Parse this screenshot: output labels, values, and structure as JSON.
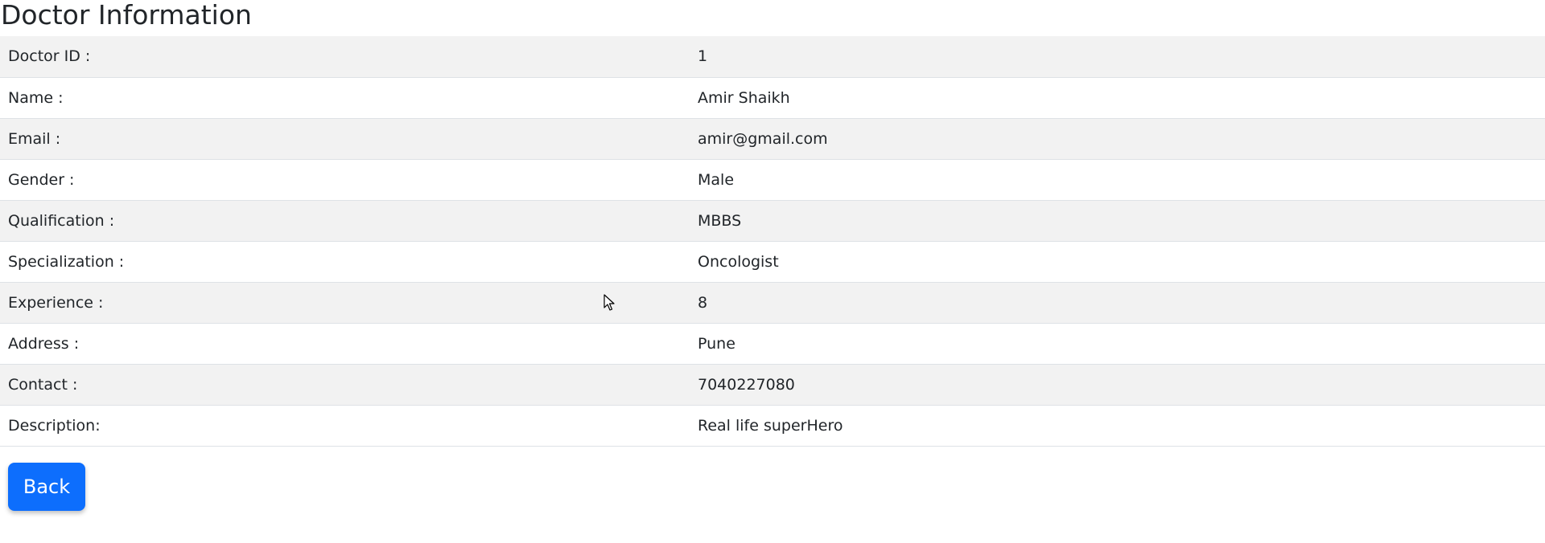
{
  "page": {
    "title": "Doctor Information"
  },
  "doctor": {
    "rows": [
      {
        "label": "Doctor ID :",
        "value": "1"
      },
      {
        "label": "Name :",
        "value": "Amir Shaikh"
      },
      {
        "label": "Email :",
        "value": "amir@gmail.com"
      },
      {
        "label": "Gender :",
        "value": "Male"
      },
      {
        "label": "Qualification :",
        "value": "MBBS"
      },
      {
        "label": "Specialization :",
        "value": "Oncologist"
      },
      {
        "label": "Experience :",
        "value": "8"
      },
      {
        "label": "Address :",
        "value": "Pune"
      },
      {
        "label": "Contact :",
        "value": "7040227080"
      },
      {
        "label": "Description:",
        "value": "Real life superHero"
      }
    ]
  },
  "actions": {
    "back_label": "Back"
  },
  "colors": {
    "primary": "#0d6efd",
    "stripe": "#f2f2f2",
    "text": "#212529"
  },
  "icons": {
    "cursor": "mouse-pointer-icon"
  }
}
